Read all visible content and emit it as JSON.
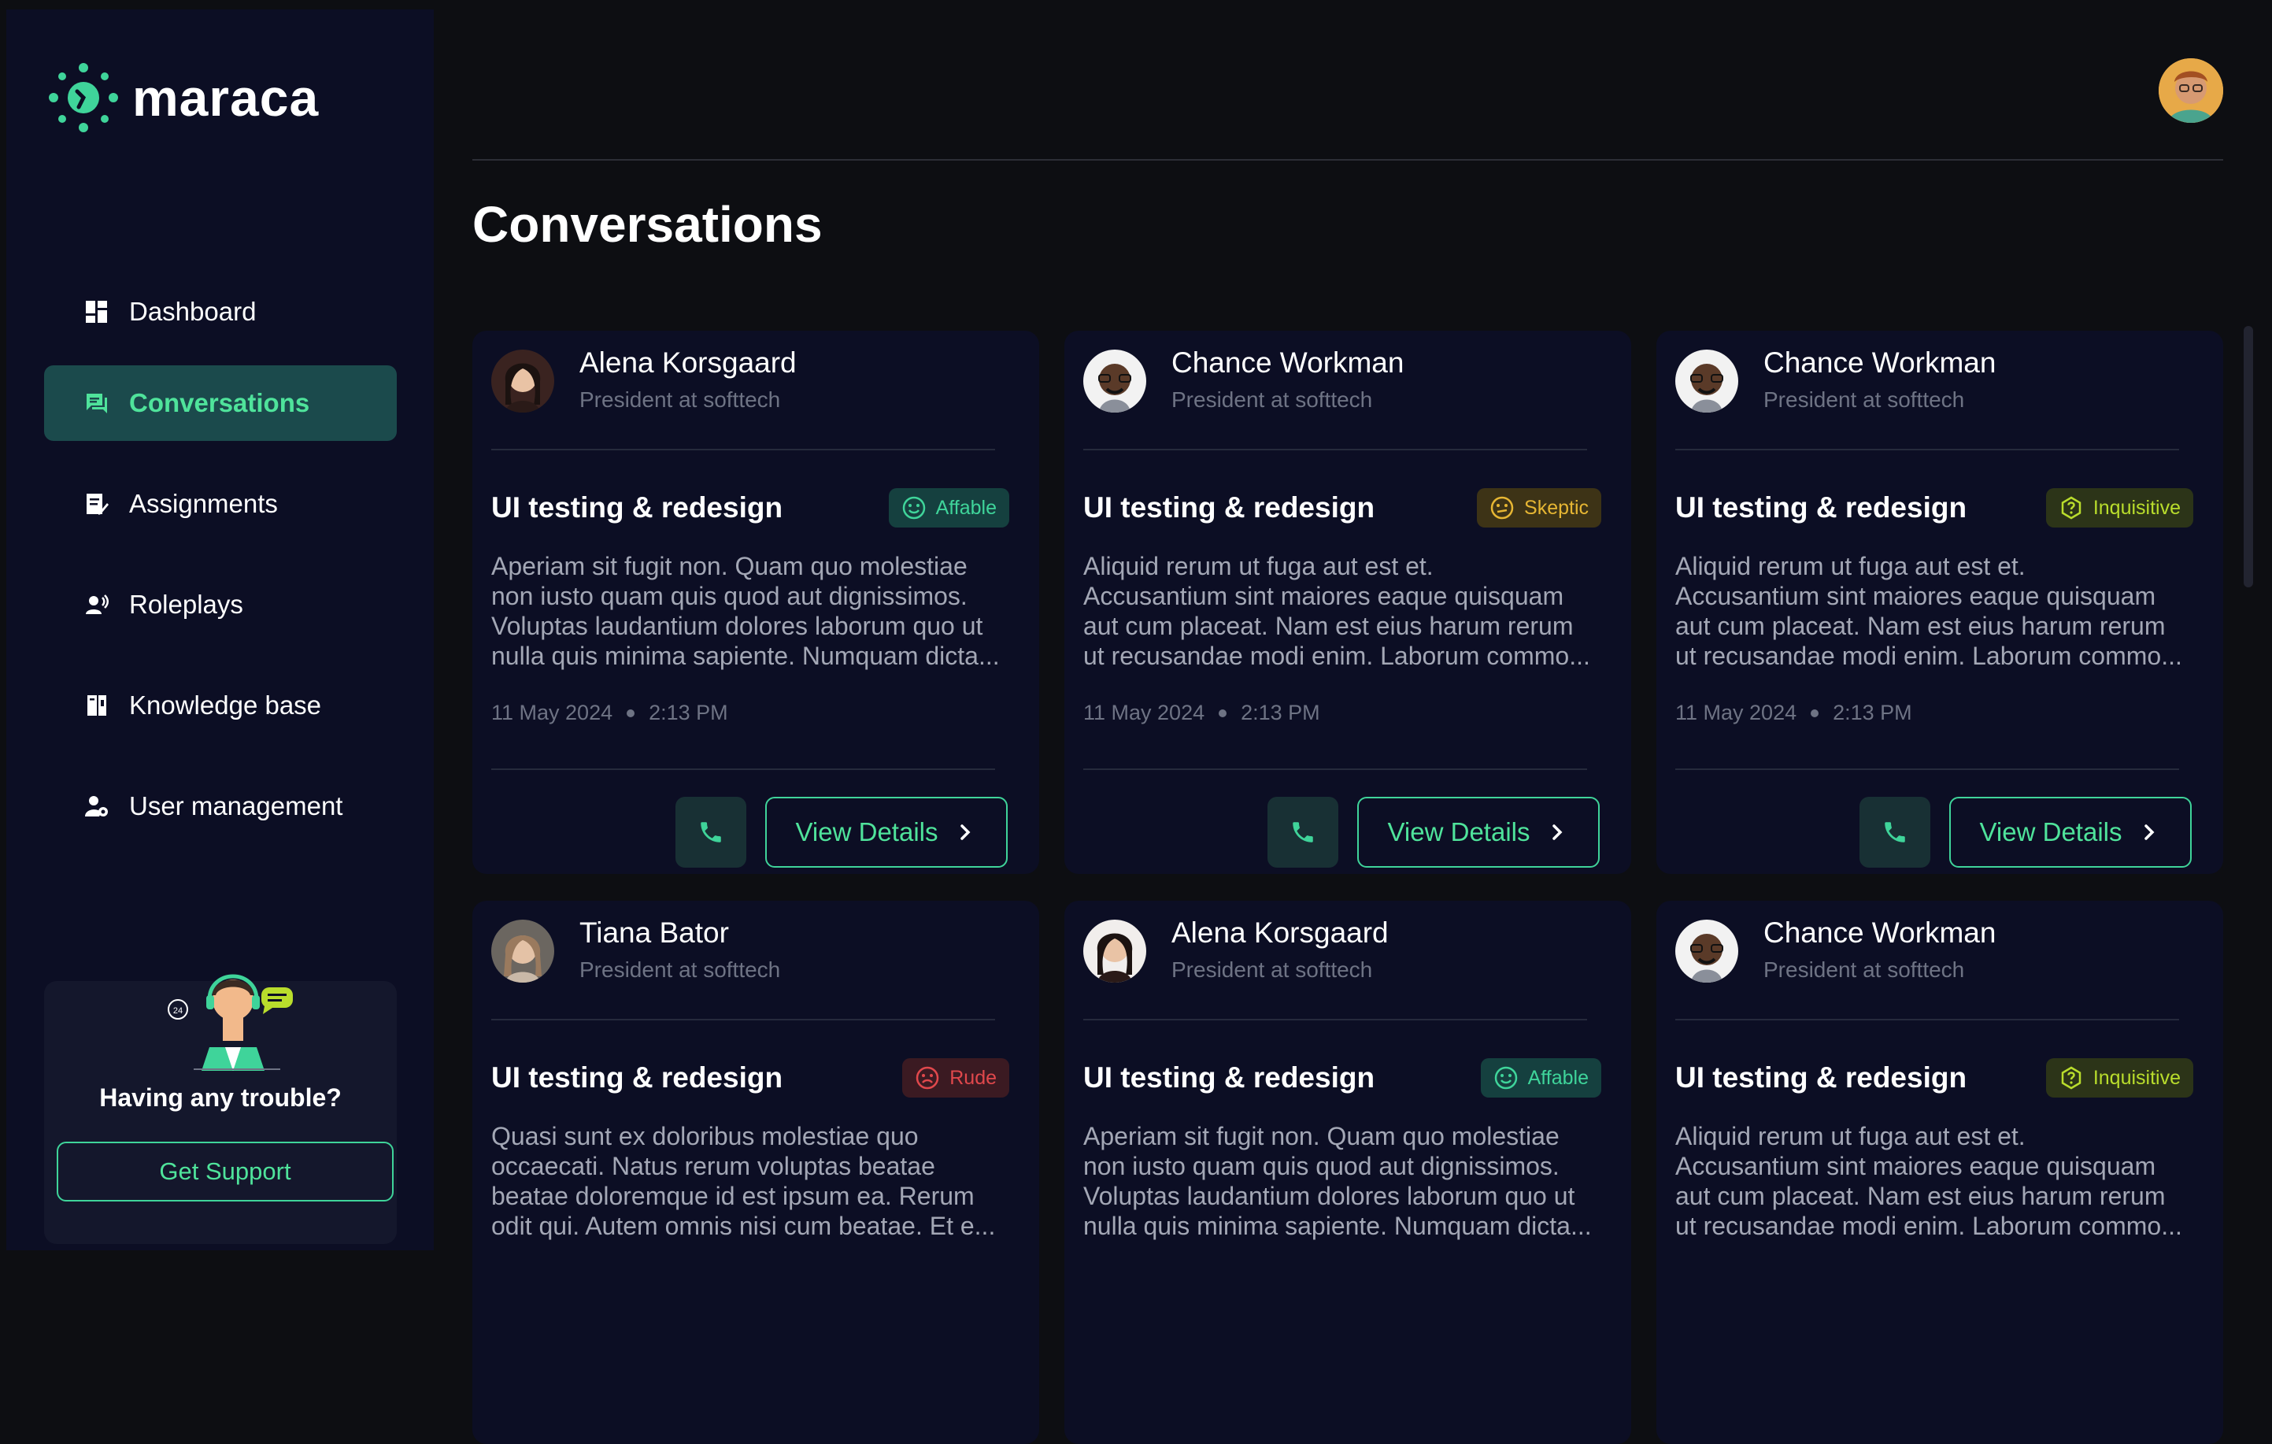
{
  "app": {
    "name": "maraca"
  },
  "sidebar": {
    "items": [
      {
        "label": "Dashboard",
        "icon": "dashboard-icon",
        "active": false
      },
      {
        "label": "Conversations",
        "icon": "chat-icon",
        "active": true
      },
      {
        "label": "Assignments",
        "icon": "assignment-icon",
        "active": false
      },
      {
        "label": "Roleplays",
        "icon": "roleplay-icon",
        "active": false
      },
      {
        "label": "Knowledge base",
        "icon": "book-icon",
        "active": false
      },
      {
        "label": "User management",
        "icon": "user-gear-icon",
        "active": false
      }
    ],
    "support": {
      "title": "Having any trouble?",
      "button": "Get Support",
      "badge_text": "24"
    }
  },
  "main": {
    "title": "Conversations",
    "cards": [
      {
        "name": "Alena Korsgaard",
        "role": "President at softtech",
        "title": "UI testing & redesign",
        "mood": "Affable",
        "desc": [
          "Aperiam sit fugit non. Quam quo molestiae",
          "non iusto quam quis quod aut dignissimos.",
          "Voluptas laudantium dolores laborum quo ut",
          "nulla quis minima sapiente. Numquam dicta..."
        ],
        "date": "11 May 2024",
        "time": "2:13 PM",
        "action": "View Details"
      },
      {
        "name": "Chance Workman",
        "role": "President at softtech",
        "title": "UI testing & redesign",
        "mood": "Skeptic",
        "desc": [
          "Aliquid rerum ut fuga aut est et.",
          "Accusantium sint maiores eaque quisquam",
          "aut cum placeat. Nam est eius harum rerum",
          "ut recusandae modi enim. Laborum commo..."
        ],
        "date": "11 May 2024",
        "time": "2:13 PM",
        "action": "View Details"
      },
      {
        "name": "Chance Workman",
        "role": "President at softtech",
        "title": "UI testing & redesign",
        "mood": "Inquisitive",
        "desc": [
          "Aliquid rerum ut fuga aut est et.",
          "Accusantium sint maiores eaque quisquam",
          "aut cum placeat. Nam est eius harum rerum",
          "ut recusandae modi enim. Laborum commo..."
        ],
        "date": "11 May 2024",
        "time": "2:13 PM",
        "action": "View Details"
      },
      {
        "name": "Tiana Bator",
        "role": "President at softtech",
        "title": "UI testing & redesign",
        "mood": "Rude",
        "desc": [
          "Quasi sunt ex doloribus molestiae quo",
          "occaecati. Natus rerum voluptas beatae",
          "beatae doloremque id est ipsum ea. Rerum",
          "odit qui. Autem omnis nisi cum beatae. Et e..."
        ]
      },
      {
        "name": "Alena Korsgaard",
        "role": "President at softtech",
        "title": "UI testing & redesign",
        "mood": "Affable",
        "desc": [
          "Aperiam sit fugit non. Quam quo molestiae",
          "non iusto quam quis quod aut dignissimos.",
          "Voluptas laudantium dolores laborum quo ut",
          "nulla quis minima sapiente. Numquam dicta..."
        ]
      },
      {
        "name": "Chance Workman",
        "role": "President at softtech",
        "title": "UI testing & redesign",
        "mood": "Inquisitive",
        "desc": [
          "Aliquid rerum ut fuga aut est et.",
          "Accusantium sint maiores eaque quisquam",
          "aut cum placeat. Nam est eius harum rerum",
          "ut recusandae modi enim. Laborum commo..."
        ]
      }
    ]
  },
  "colors": {
    "accent": "#4fe39b",
    "sidebar_bg": "#0c0e24",
    "page_bg": "#0d0e12",
    "affable": "#3fd49a",
    "skeptic": "#e6b633",
    "inquisitive": "#b9dd2c",
    "rude": "#e0484c"
  }
}
